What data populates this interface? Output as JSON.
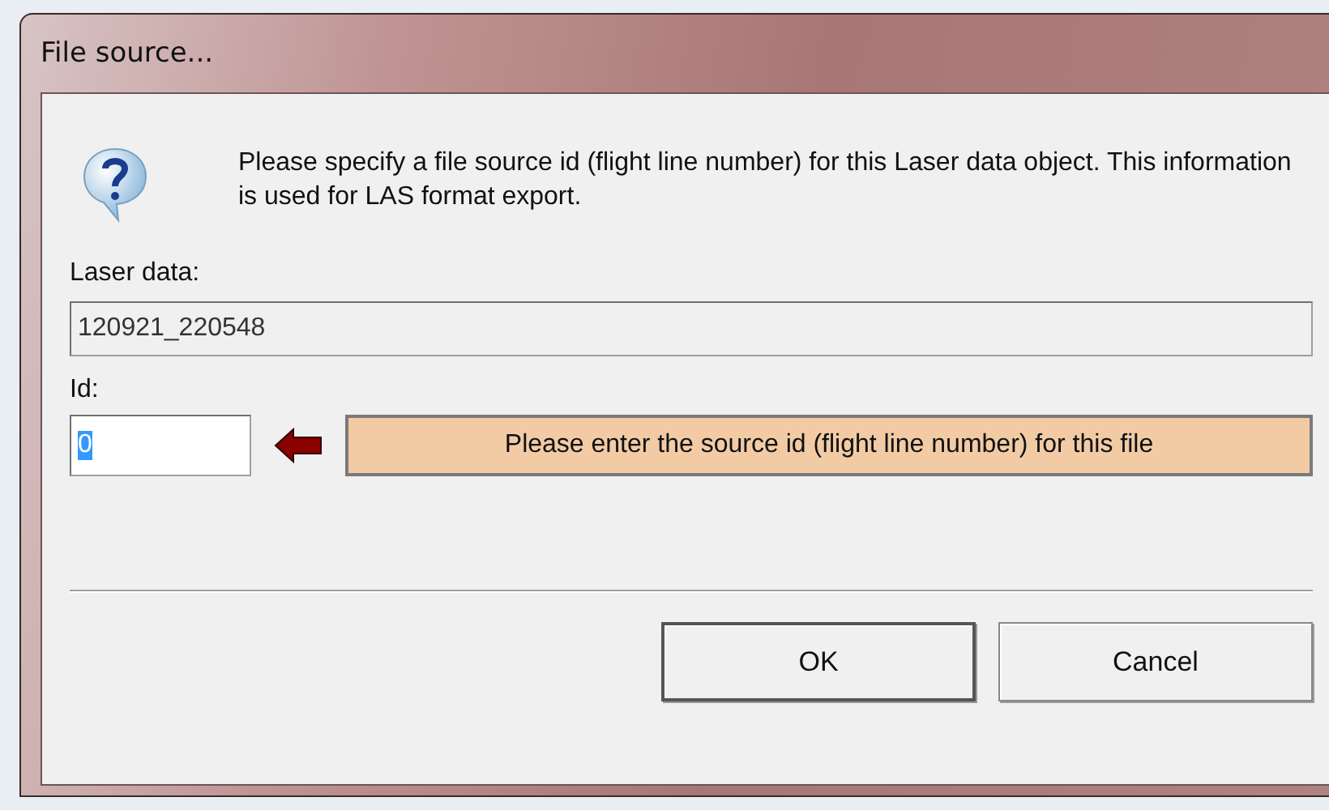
{
  "window": {
    "title": "File source..."
  },
  "message": "Please specify a file source id (flight line number) for this Laser data object. This information is used for LAS format export.",
  "laser_data": {
    "label": "Laser data:",
    "value": "120921_220548",
    "disabled": true
  },
  "id": {
    "label": "Id:",
    "value": "0",
    "text_selected": true
  },
  "hint": "Please enter the source id (flight line number) for this file",
  "buttons": [
    {
      "label": "OK",
      "default": true
    },
    {
      "label": "Cancel",
      "default": false
    }
  ]
}
